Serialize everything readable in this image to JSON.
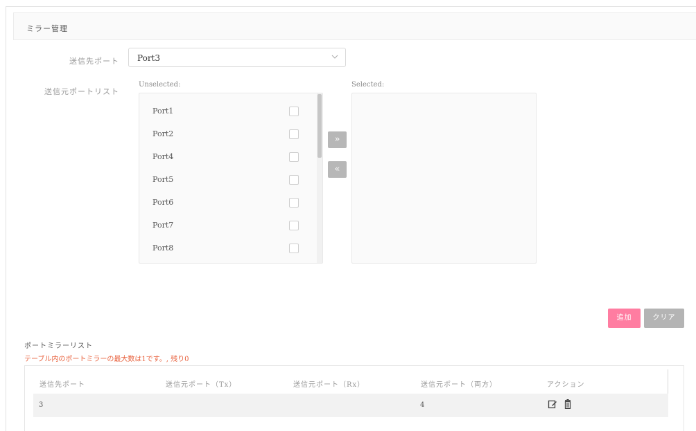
{
  "panel": {
    "title": "ミラー管理"
  },
  "form": {
    "dest_label": "送信先ポート",
    "dest_value": "Port3",
    "src_label": "送信元ポートリスト",
    "unselected_caption": "Unselected:",
    "selected_caption": "Selected:",
    "unselected_ports": [
      "Port1",
      "Port2",
      "Port4",
      "Port5",
      "Port6",
      "Port7",
      "Port8"
    ],
    "move_right_glyph": "»",
    "move_left_glyph": "«"
  },
  "buttons": {
    "add": "追加",
    "clear": "クリア"
  },
  "list": {
    "title": "ポートミラーリスト",
    "warning": "テーブル内のポートミラーの最大数は1です。, 残り0",
    "columns": [
      "送信先ポート",
      "送信元ポート（Tx）",
      "送信元ポート（Rx）",
      "送信元ポート（両方）",
      "アクション"
    ],
    "rows": [
      {
        "dest": "3",
        "tx": "",
        "rx": "",
        "both": "4"
      }
    ]
  },
  "icons": {
    "chevron": "chevron-down-icon",
    "edit": "edit-icon",
    "delete": "trash-icon"
  },
  "colors": {
    "add_button": "#ff7da1",
    "clear_button": "#b4b4b4",
    "warning": "#e8603c",
    "move_button": "#b7b7b7"
  }
}
